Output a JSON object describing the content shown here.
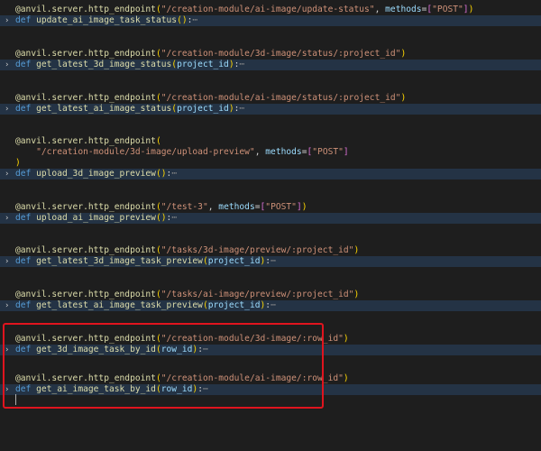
{
  "editor": {
    "language": "python",
    "blocks": [
      {
        "decorator_name": "anvil.server.http_endpoint",
        "path": "\"/creation-module/ai-image/update-status\"",
        "methods_kw": "methods",
        "methods_value": "\"POST\"",
        "func_name": "update_ai_image_task_status",
        "param": ""
      },
      {
        "decorator_name": "anvil.server.http_endpoint",
        "path": "\"/creation-module/3d-image/status/:project_id\"",
        "func_name": "get_latest_3d_image_status",
        "param": "project_id"
      },
      {
        "decorator_name": "anvil.server.http_endpoint",
        "path": "\"/creation-module/ai-image/status/:project_id\"",
        "func_name": "get_latest_ai_image_status",
        "param": "project_id"
      },
      {
        "decorator_name": "anvil.server.http_endpoint",
        "path": "\"/creation-module/3d-image/upload-preview\"",
        "methods_kw": "methods",
        "methods_value": "\"POST\"",
        "func_name": "upload_3d_image_preview",
        "param": ""
      },
      {
        "decorator_name": "anvil.server.http_endpoint",
        "path": "\"/test-3\"",
        "methods_kw": "methods",
        "methods_value": "\"POST\"",
        "func_name": "upload_ai_image_preview",
        "param": ""
      },
      {
        "decorator_name": "anvil.server.http_endpoint",
        "path": "\"/tasks/3d-image/preview/:project_id\"",
        "func_name": "get_latest_3d_image_task_preview",
        "param": "project_id"
      },
      {
        "decorator_name": "anvil.server.http_endpoint",
        "path": "\"/tasks/ai-image/preview/:project_id\"",
        "func_name": "get_latest_ai_image_task_preview",
        "param": "project_id"
      },
      {
        "decorator_name": "anvil.server.http_endpoint",
        "path": "\"/creation-module/3d-image/:row_id\"",
        "func_name": "get_3d_image_task_by_id",
        "param": "row_id"
      },
      {
        "decorator_name": "anvil.server.http_endpoint",
        "path": "\"/creation-module/ai-image/:row_id\"",
        "func_name": "get_ai_image_task_by_id",
        "param": "row_id"
      }
    ],
    "tokens": {
      "at": "@",
      "def_kw": "def",
      "fold_icon": "›",
      "ellipsis": "⋯",
      "colon": ":",
      "comma": ", ",
      "equals": "=",
      "open_paren": "(",
      "close_paren": ")",
      "open_bracket": "[",
      "close_bracket": "]"
    },
    "colors": {
      "background": "#1e1e1e",
      "folded_line_bg": "#243345",
      "highlight_box": "#e0141e"
    }
  }
}
